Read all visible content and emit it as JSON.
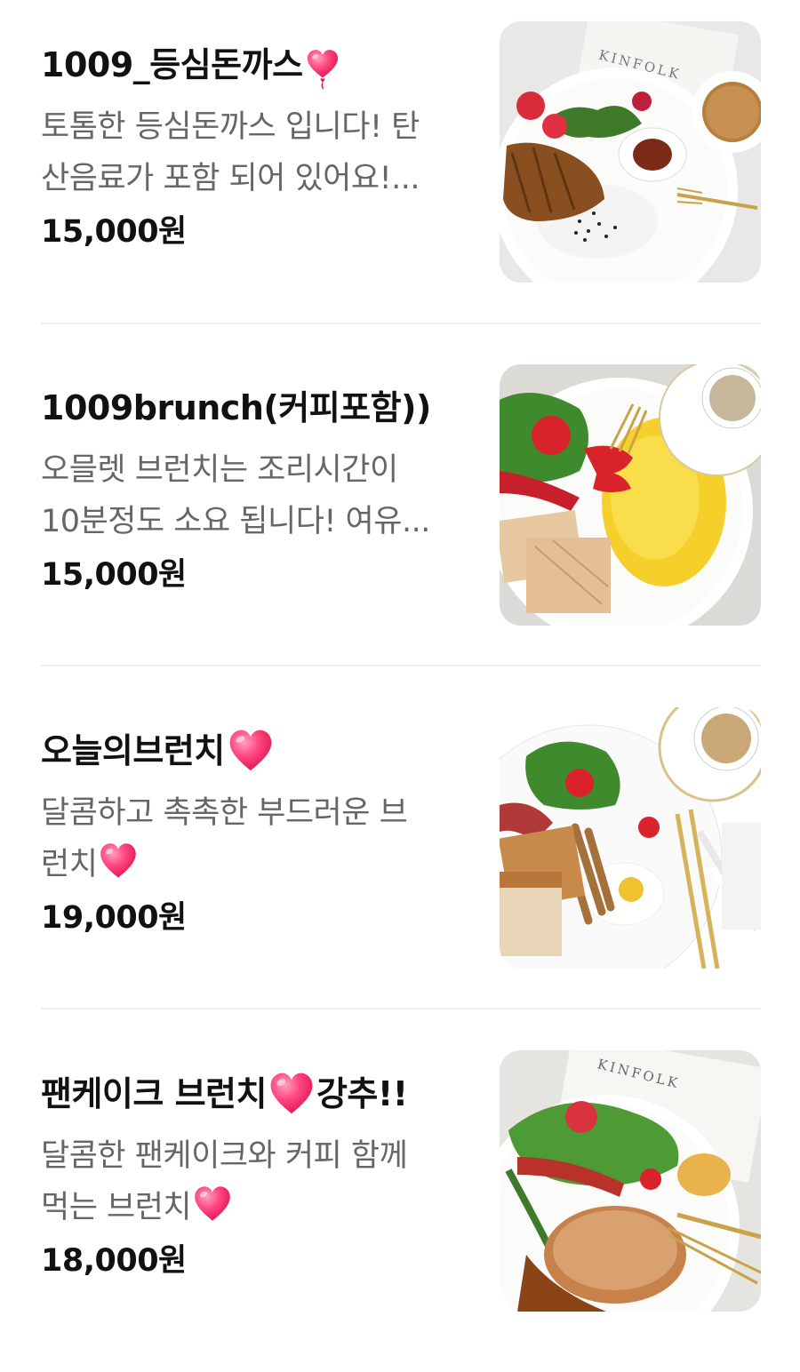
{
  "menu": {
    "items": [
      {
        "name": "1009_등심돈까스",
        "name_icon": "heart-balloon-icon",
        "desc_line1": "토톰한 등심돈까스 입니다! 탄",
        "desc_line2": "산음료가 포함 되어 있어요!...",
        "price": "15,000원",
        "image_icon": "tonkatsu-plate-photo"
      },
      {
        "name": "1009brunch(커피포함))",
        "desc_line1": "오믈렛 브런치는 조리시간이",
        "desc_line2": "10분정도 소요 됩니다! 여유...",
        "price": "15,000원",
        "image_icon": "omelet-brunch-photo"
      },
      {
        "name": "오늘의브런치",
        "name_icon": "heart-icon",
        "desc_line1": "달콤하고 촉촉한 부드러운 브",
        "desc_line2": "런치",
        "desc_icon": "heart-icon",
        "price": "19,000원",
        "image_icon": "french-toast-brunch-photo"
      },
      {
        "name_part1": "팬케이크 브런치",
        "name_part2": "강추!!",
        "name_icon": "heart-icon",
        "desc_line1": "달콤한 팬케이크와 커피 함께",
        "desc_line2": "먹는 브런치",
        "desc_icon": "heart-icon",
        "price": "18,000원",
        "image_icon": "pancake-brunch-photo"
      }
    ]
  },
  "colors": {
    "text": "#111111",
    "desc": "#666666",
    "divider": "#efefef",
    "heart": "#ff3d7a"
  }
}
